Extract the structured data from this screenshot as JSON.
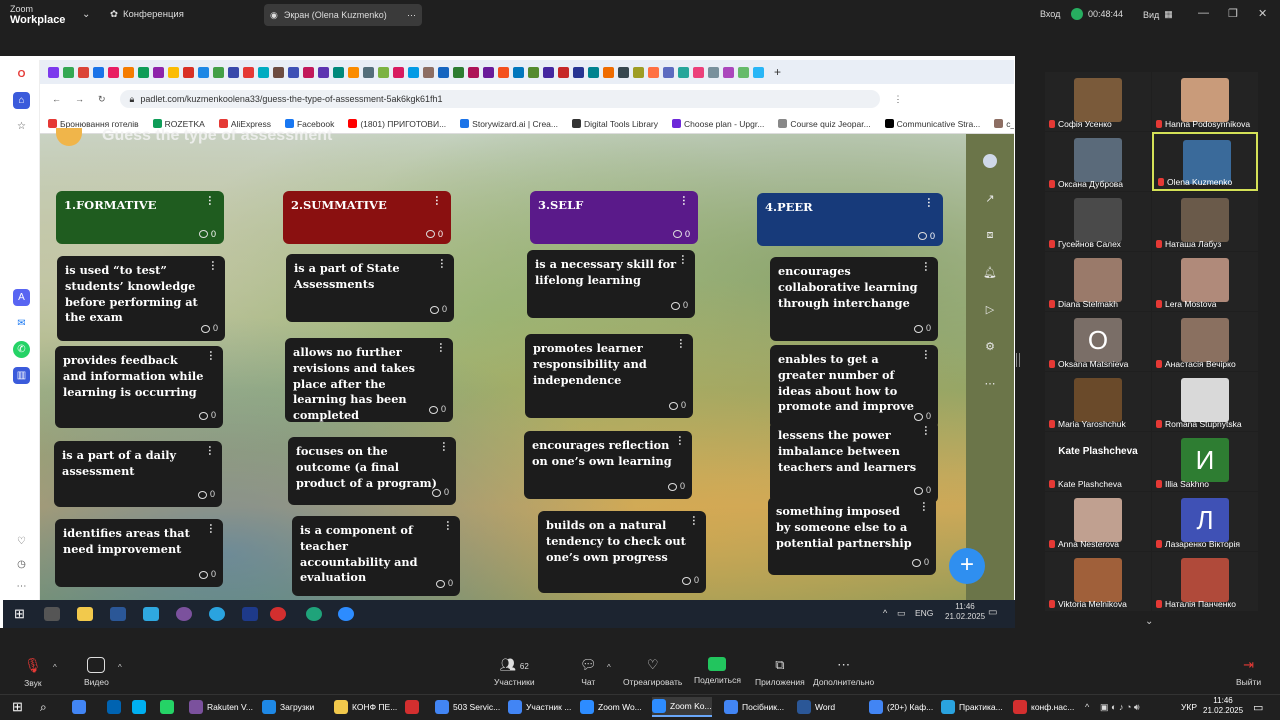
{
  "zoom_top": {
    "app_top": "Zoom",
    "app_bottom": "Workplace",
    "meeting_label": "Конференция",
    "share_label": "Экран (Olena Kuzmenko)",
    "enter_label": "Вход",
    "timer": "00:48:44",
    "view_label": "Вид"
  },
  "browser": {
    "url": "padlet.com/kuzmenkoolena33/guess-the-type-of-assessment-5ak6kgk61fh1",
    "bookmarks": [
      "Бронювання готелів",
      "ROZETKA",
      "AliExpress",
      "Facebook",
      "(1801) ПРИГОТОВИ...",
      "Storywizard.ai | Crea...",
      "Digital Tools Library",
      "Choose plan - Upgr...",
      "Course quiz Jeopar...",
      "Communicative Stra...",
      "c_feedback.pdf"
    ]
  },
  "board": {
    "title": "Guess the type of assessment",
    "columns": [
      {
        "title": "1.FORMATIVE",
        "color": "#1f5c1f",
        "comments": "0",
        "cards": [
          {
            "text": "is used “to test” students’ knowledge before performing at the exam",
            "comments": "0"
          },
          {
            "text": "provides feedback and information while learning is occurring",
            "comments": "0"
          },
          {
            "text": "is a part of a daily assessment",
            "comments": "0"
          },
          {
            "text": "identifies areas that need improvement",
            "comments": "0"
          }
        ]
      },
      {
        "title": "2.SUMMATIVE",
        "color": "#8a1010",
        "comments": "0",
        "cards": [
          {
            "text": "is a part of State Assessments",
            "comments": "0"
          },
          {
            "text": "allows no further revisions and takes place after the learning has been completed",
            "comments": "0"
          },
          {
            "text": "focuses on the outcome (a final product of a program)",
            "comments": "0"
          },
          {
            "text": "is a component of teacher accountability and evaluation",
            "comments": "0"
          }
        ]
      },
      {
        "title": "3.SELF",
        "color": "#5a1a8a",
        "comments": "0",
        "cards": [
          {
            "text": "is a necessary skill for lifelong learning",
            "comments": "0"
          },
          {
            "text": "promotes learner responsibility and independence",
            "comments": "0"
          },
          {
            "text": "encourages reflection on one’s own learning",
            "comments": "0"
          },
          {
            "text": "builds on a natural tendency to check out one’s own progress",
            "comments": "0"
          }
        ]
      },
      {
        "title": "4.PEER",
        "color": "#173a7a",
        "comments": "0",
        "cards": [
          {
            "text": "encourages collaborative learning through interchange",
            "comments": "0"
          },
          {
            "text": "enables to get a greater number of ideas about how to promote and improve",
            "comments": "0"
          },
          {
            "text": "lessens the power imbalance between teachers and learners",
            "comments": "0"
          },
          {
            "text": "something imposed by someone else to a potential partnership",
            "comments": "0"
          }
        ]
      }
    ]
  },
  "shared_taskbar": {
    "lang": "ENG",
    "time": "11:46",
    "date": "21.02.2025"
  },
  "participants": [
    {
      "name": "Софія Усенко",
      "color": "#7a5a3a"
    },
    {
      "name": "Hanna Podosynnikova",
      "color": "#c99b7a"
    },
    {
      "name": "Оксана Дуброва",
      "color": "#5a6a7a"
    },
    {
      "name": "Olena Kuzmenko",
      "color": "#3a6a9a",
      "active": true
    },
    {
      "name": "Гусейнов Салех",
      "color": "#4a4a4a"
    },
    {
      "name": "Наташа Лабуз",
      "color": "#6a5a4a"
    },
    {
      "name": "Diana Stelmakh",
      "color": "#9a7a6a"
    },
    {
      "name": "Lera Mostova",
      "color": "#b08a7a"
    },
    {
      "name": "Oksana Matsnieva",
      "initial": "O",
      "color": "#7a6e67"
    },
    {
      "name": "Анастасія Вечірко",
      "color": "#8a7060"
    },
    {
      "name": "Maria Yaroshchuk",
      "color": "#6a4a2a"
    },
    {
      "name": "Romana Stupnytska",
      "color": "#d9d9d9"
    },
    {
      "name": "Kate Plashcheva",
      "textonly": true
    },
    {
      "name": "Illia Sakhno",
      "initial": "И",
      "color": "#2e7d32"
    },
    {
      "name": "Anna Nesterova",
      "color": "#c0a090"
    },
    {
      "name": "Лазаренко Вікторія",
      "initial": "Л",
      "color": "#3f51b5"
    },
    {
      "name": "Viktoria Melnikova",
      "color": "#a0603a"
    },
    {
      "name": "Наталія Панченко",
      "color": "#b04a3a"
    }
  ],
  "zoom_controls": {
    "audio": "Звук",
    "video": "Видео",
    "participants": "Участники",
    "participants_count": "62",
    "chat": "Чат",
    "react": "Отреагировать",
    "share": "Поделиться",
    "apps": "Приложения",
    "more": "Дополнительно",
    "leave": "Выйти"
  },
  "taskbar": {
    "items": [
      "Rakuten V...",
      "Загрузки",
      "КОНФ ПЕ...",
      "503 Servic...",
      "Участник ...",
      "Zoom Wo...",
      "Zoom Ko...",
      "Посібник...",
      "Word",
      "(20+) Каф...",
      "Практика...",
      "конф.нас..."
    ],
    "lang": "УКР",
    "time": "11:46",
    "date": "21.02.2025"
  }
}
